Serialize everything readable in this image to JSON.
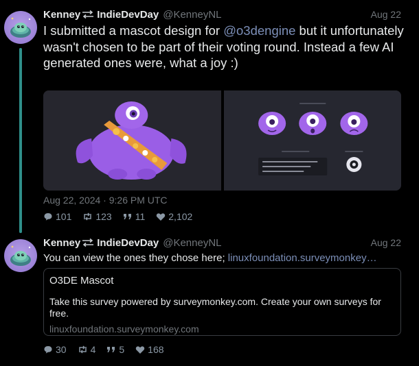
{
  "tweets": [
    {
      "author": {
        "name": "Kenney",
        "name_suffix": "IndieDevDay",
        "handle": "@KenneyNL",
        "avatar_icon": "turtle-avatar"
      },
      "date": "Aug 22",
      "text_prefix": "I submitted a mascot design for ",
      "mention": "@o3dengine",
      "text_suffix": " but it unfortunately wasn't chosen to be part of their voting round. Instead a few AI generated ones were, what a joy :)",
      "media": [
        {
          "icon": "purple-cyclops-mascot-image"
        },
        {
          "icon": "mascot-expressions-sheet-image"
        }
      ],
      "timestamp": "Aug 22, 2024 · 9:26 PM UTC",
      "stats": {
        "replies": "101",
        "retweets": "123",
        "quotes": "11",
        "likes": "2,102"
      }
    },
    {
      "author": {
        "name": "Kenney",
        "name_suffix": "IndieDevDay",
        "handle": "@KenneyNL",
        "avatar_icon": "turtle-avatar"
      },
      "date": "Aug 22",
      "text_prefix": "You can view the ones they chose here; ",
      "link": "linuxfoundation.surveymonkey…",
      "card": {
        "title": "O3DE Mascot",
        "description": "Take this survey powered by surveymonkey.com. Create your own surveys for free.",
        "domain": "linuxfoundation.surveymonkey.com"
      },
      "stats": {
        "replies": "30",
        "retweets": "4",
        "quotes": "5",
        "likes": "168"
      }
    }
  ],
  "colors": {
    "background": "#000000",
    "text": "#e7e9ea",
    "muted": "#71767b",
    "link": "#7c8fb8",
    "thread_line": "#2f8f8a",
    "avatar_bg": "#a58fdd"
  }
}
